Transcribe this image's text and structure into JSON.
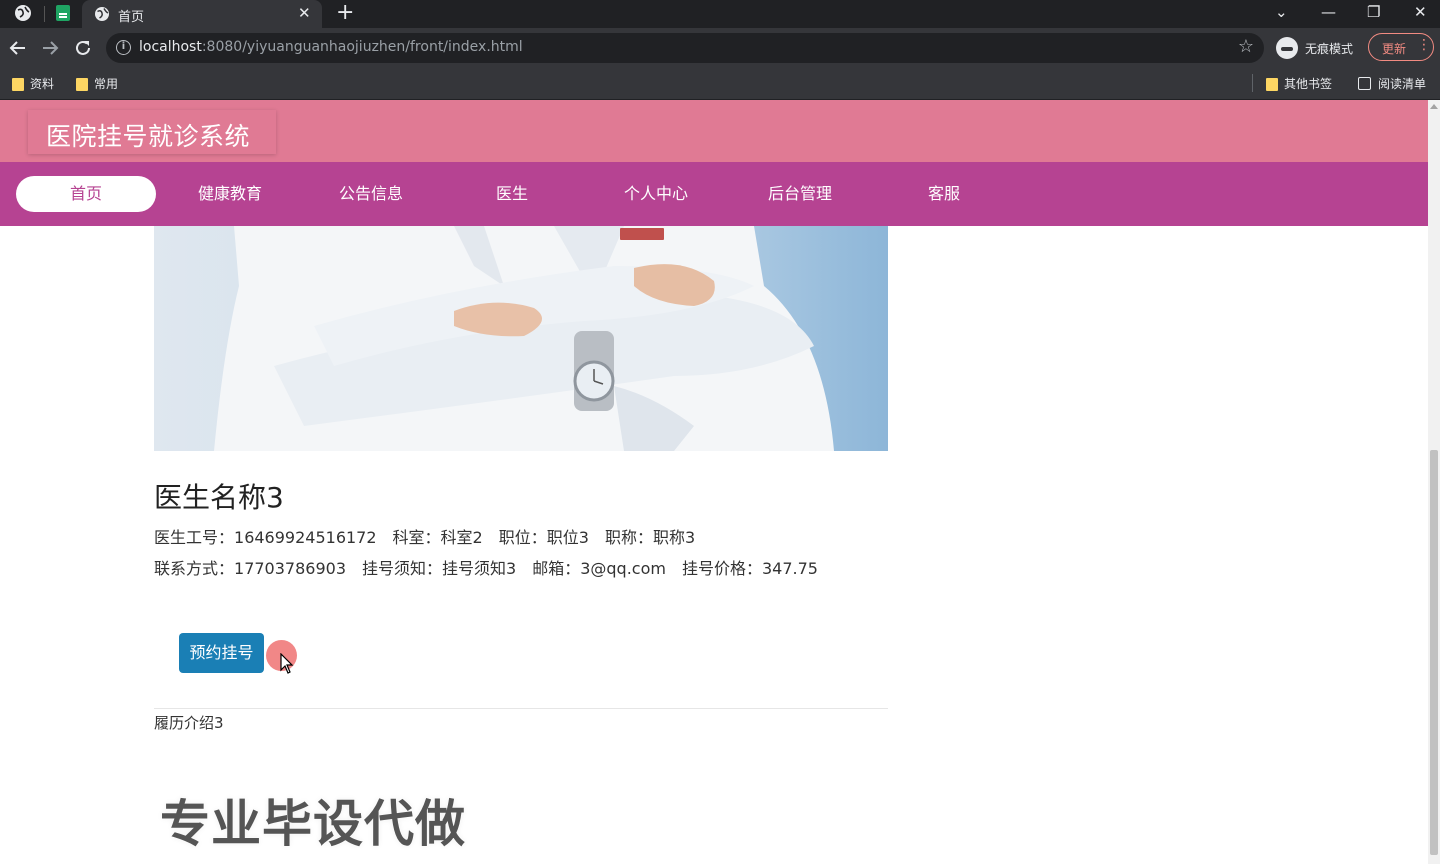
{
  "browser": {
    "tab_title": "首页",
    "tab_close": "✕",
    "new_tab": "+",
    "window_controls": [
      "⌄",
      "—",
      "❐",
      "✕"
    ],
    "url_host": "localhost",
    "url_rest": ":8080/yiyuanguanhaojiuzhen/front/index.html",
    "incognito_label": "无痕模式",
    "update_label": "更新",
    "bookmarks_left": [
      "资料",
      "常用"
    ],
    "bookmarks_right": [
      "其他书签",
      "阅读清单"
    ]
  },
  "site": {
    "title": "医院挂号就诊系统",
    "nav": [
      "首页",
      "健康教育",
      "公告信息",
      "医生",
      "个人中心",
      "后台管理",
      "客服"
    ],
    "active_nav": "首页"
  },
  "doctor": {
    "name": "医生名称3",
    "line1": [
      {
        "label": "医生工号：",
        "value": "16469924516172"
      },
      {
        "label": "科室：",
        "value": "科室2"
      },
      {
        "label": "职位：",
        "value": "职位3"
      },
      {
        "label": "职称：",
        "value": "职称3"
      }
    ],
    "line2": [
      {
        "label": "联系方式：",
        "value": "17703786903"
      },
      {
        "label": "挂号须知：",
        "value": "挂号须知3"
      },
      {
        "label": "邮箱：",
        "value": "3@qq.com"
      },
      {
        "label": "挂号价格：",
        "value": "347.75"
      }
    ],
    "book_button": "预约挂号",
    "resume": "履历介绍3"
  },
  "watermark": "专业毕设代做",
  "colors": {
    "header_pink": "#e07a94",
    "nav_magenta": "#b64392",
    "button_blue": "#1a7fb5"
  }
}
